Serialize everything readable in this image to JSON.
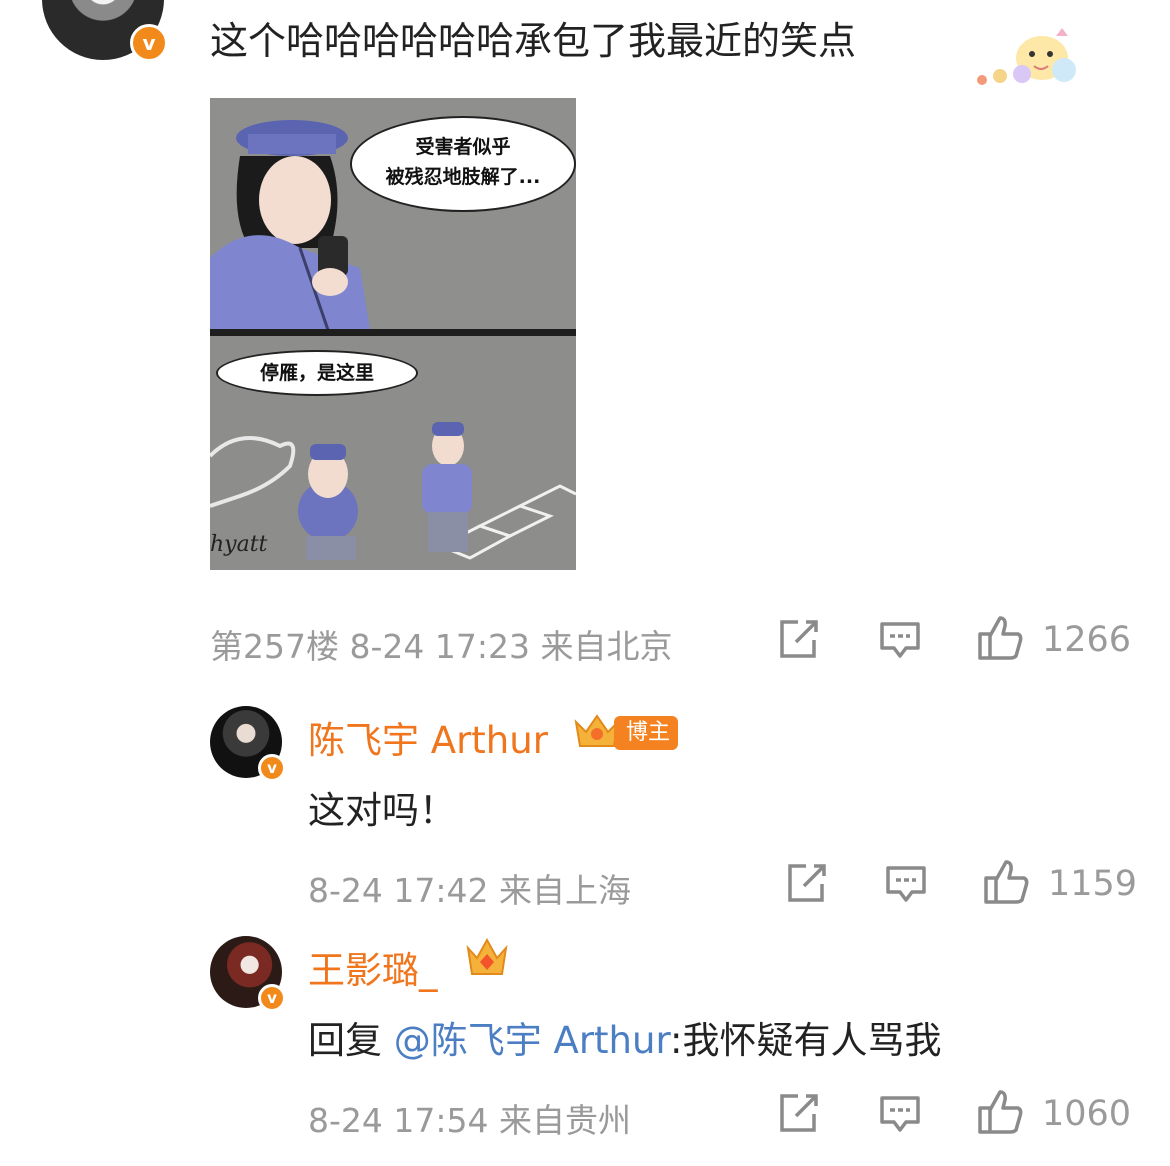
{
  "top_comment": {
    "text": "这个哈哈哈哈哈哈承包了我最近的笑点",
    "vbadge": "v",
    "sticker_icon": "cartoon-sticker-icon",
    "image": {
      "bubble1_line1": "受害者似乎",
      "bubble1_line2": "被残忍地肢解了...",
      "bubble2": "停雁，是这里",
      "watermark": "hyatt"
    },
    "meta": "第257楼 8-24 17:23 来自北京",
    "like_count": "1266"
  },
  "replies": [
    {
      "name": "陈飞宇 Arthur",
      "vbadge": "v",
      "tag": "博主",
      "text": "这对吗！",
      "meta": "8-24 17:42 来自上海",
      "like_count": "1159"
    },
    {
      "name": "王影璐_",
      "vbadge": "v",
      "reply_prefix": "回复 ",
      "mention": "@陈飞宇 Arthur",
      "text": ":我怀疑有人骂我",
      "meta": "8-24 17:54 来自贵州",
      "like_count": "1060"
    }
  ],
  "colors": {
    "name": "#f0761e",
    "mention": "#4c7ec4",
    "meta": "#9a9a9a",
    "vbadge": "#f28a1b"
  }
}
